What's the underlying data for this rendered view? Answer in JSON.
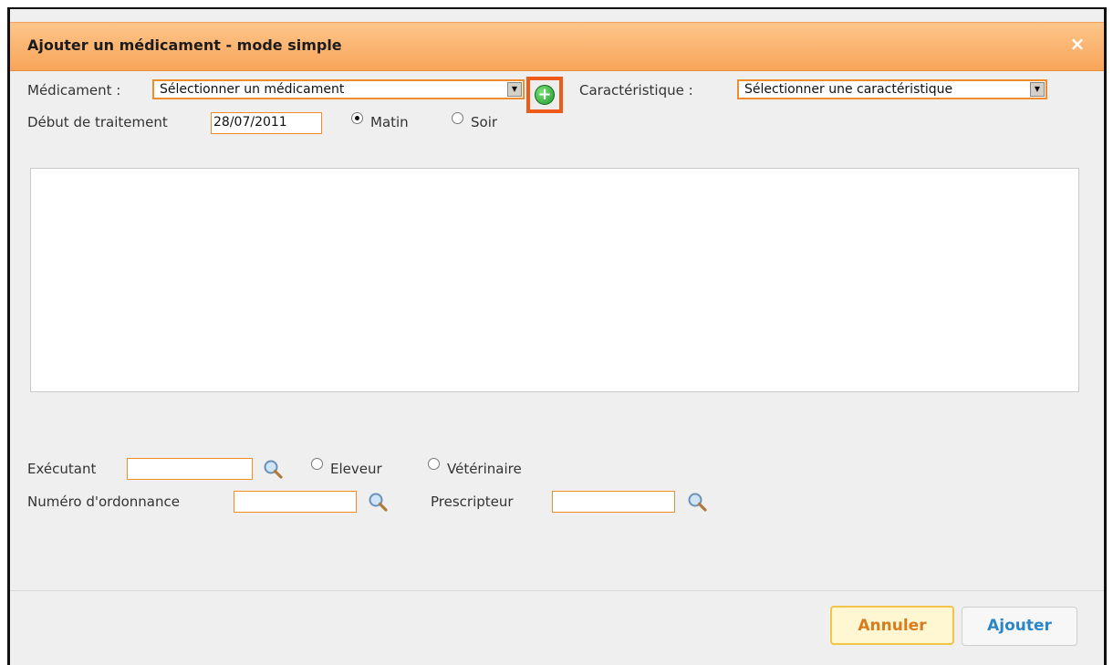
{
  "dialog": {
    "title": "Ajouter un médicament - mode simple",
    "close_label": "×"
  },
  "form": {
    "medicament_label": "Médicament :",
    "medicament_value": "Sélectionner un médicament",
    "caracteristique_label": "Caractéristique :",
    "caracteristique_value": "Sélectionner une caractéristique",
    "debut_label": "Début de traitement",
    "debut_value": "28/07/2011",
    "matin_label": "Matin",
    "soir_label": "Soir",
    "matin_checked": true,
    "executant_label": "Exécutant",
    "eleveur_label": "Eleveur",
    "veterinaire_label": "Vétérinaire",
    "ordonnance_label": "Numéro d'ordonnance",
    "prescripteur_label": "Prescripteur"
  },
  "buttons": {
    "cancel_label": "Annuler",
    "add_label": "Ajouter"
  },
  "colors": {
    "accent": "#f08c2b",
    "highlight": "#f05a18",
    "title_bg": "#fbb36f",
    "add_button_text": "#2b86c5",
    "cancel_button_text": "#d97c1c"
  }
}
